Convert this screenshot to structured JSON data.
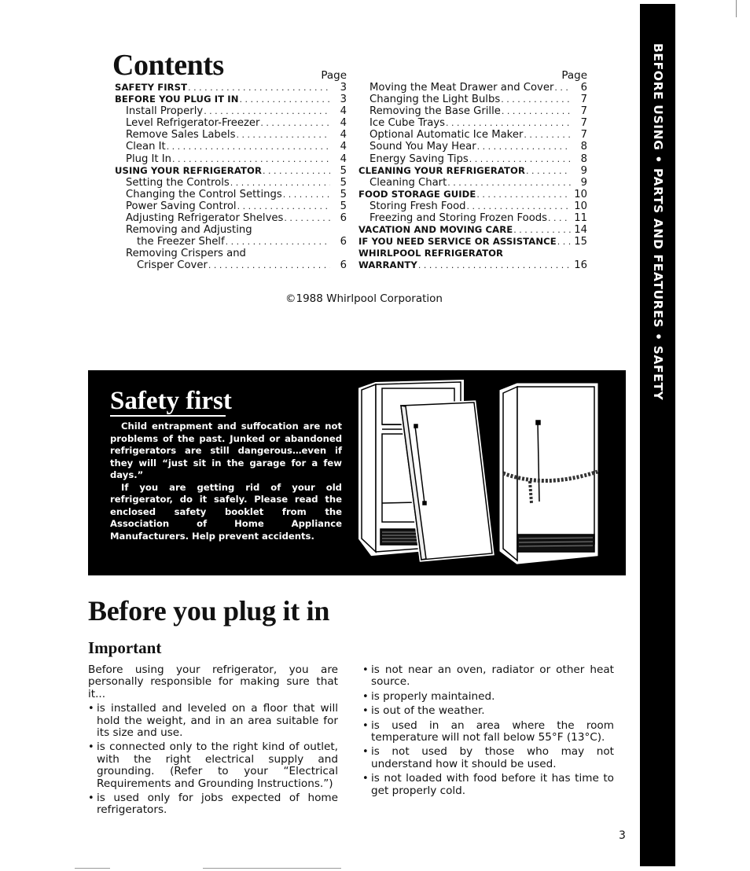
{
  "contents": {
    "title": "Contents",
    "page_header": "Page",
    "left_column": [
      {
        "label": "SAFETY FIRST",
        "page": "3",
        "level": "main"
      },
      {
        "label": "BEFORE YOU PLUG IT IN",
        "page": "3",
        "level": "main"
      },
      {
        "label": "Install Properly",
        "page": "4",
        "level": "sub"
      },
      {
        "label": "Level Refrigerator-Freezer",
        "page": "4",
        "level": "sub"
      },
      {
        "label": "Remove Sales Labels",
        "page": "4",
        "level": "sub"
      },
      {
        "label": "Clean It",
        "page": "4",
        "level": "sub"
      },
      {
        "label": "Plug It In",
        "page": "4",
        "level": "sub"
      },
      {
        "label": "USING YOUR REFRIGERATOR",
        "page": "5",
        "level": "main"
      },
      {
        "label": "Setting the Controls",
        "page": "5",
        "level": "sub"
      },
      {
        "label": "Changing the Control Settings",
        "page": "5",
        "level": "sub"
      },
      {
        "label": "Power Saving Control",
        "page": "5",
        "level": "sub"
      },
      {
        "label": "Adjusting Refrigerator Shelves",
        "page": "6",
        "level": "sub"
      },
      {
        "label": "Removing and Adjusting",
        "page": "",
        "level": "sub-head"
      },
      {
        "label": "the Freezer Shelf",
        "page": "6",
        "level": "sub2"
      },
      {
        "label": "Removing Crispers and",
        "page": "",
        "level": "sub-head"
      },
      {
        "label": "Crisper Cover",
        "page": "6",
        "level": "sub2"
      }
    ],
    "right_column": [
      {
        "label": "Moving the Meat Drawer and Cover",
        "page": "6",
        "level": "sub"
      },
      {
        "label": "Changing the Light Bulbs",
        "page": "7",
        "level": "sub"
      },
      {
        "label": "Removing the Base Grille",
        "page": "7",
        "level": "sub"
      },
      {
        "label": "Ice Cube Trays",
        "page": "7",
        "level": "sub"
      },
      {
        "label": "Optional Automatic Ice Maker",
        "page": "7",
        "level": "sub"
      },
      {
        "label": "Sound You May Hear",
        "page": "8",
        "level": "sub"
      },
      {
        "label": "Energy Saving Tips",
        "page": "8",
        "level": "sub"
      },
      {
        "label": "CLEANING YOUR REFRIGERATOR",
        "page": "9",
        "level": "main"
      },
      {
        "label": "Cleaning Chart",
        "page": "9",
        "level": "sub"
      },
      {
        "label": "FOOD STORAGE GUIDE",
        "page": "10",
        "level": "main"
      },
      {
        "label": "Storing Fresh Food",
        "page": "10",
        "level": "sub"
      },
      {
        "label": "Freezing and Storing Frozen Foods",
        "page": "11",
        "level": "sub"
      },
      {
        "label": "VACATION AND MOVING CARE",
        "page": "14",
        "level": "main"
      },
      {
        "label": "IF YOU NEED SERVICE OR ASSISTANCE",
        "page": "15",
        "level": "main"
      },
      {
        "label": "WHIRLPOOL REFRIGERATOR",
        "page": "",
        "level": "main-head"
      },
      {
        "label": "WARRANTY",
        "page": "16",
        "level": "main"
      }
    ],
    "copyright": "©1988 Whirlpool Corporation"
  },
  "side_tab": {
    "text": "BEFORE USING • PARTS AND FEATURES • SAFETY"
  },
  "safety": {
    "title": "Safety first",
    "paragraphs": [
      "Child entrapment and suffocation are not problems of the past. Junked or abandoned refrigerators are still dangerous…even if they will “just sit in the garage for a few days.”",
      "If you are getting rid of your old refrigerator, do it safely. Please read the enclosed safety booklet from the Association of Home Appliance Manufacturers. Help prevent accidents."
    ],
    "illustration": "refrigerator-door-removed-and-chained-illustration"
  },
  "before_you_plug": {
    "title": "Before you plug it in",
    "subtitle": "Important",
    "intro": "Before using your refrigerator, you are personally responsible for making sure that it...",
    "left_bullets": [
      "is installed and leveled on a floor that will hold the weight, and in an area suitable for its size and use.",
      "is connected only to the right kind of outlet, with the right electrical supply and grounding. (Refer to your “Electrical Requirements and Grounding Instructions.”)",
      "is used only for jobs expected of home refrigerators."
    ],
    "right_bullets": [
      "is not near an oven, radiator or other heat source.",
      "is properly maintained.",
      "is out of the weather.",
      "is used in an area where the room temperature will not fall below 55°F (13°C).",
      "is not used by those who may not understand how it should be used.",
      "is not loaded with food before it has time to get properly cold."
    ],
    "bullet_glyph": "•"
  },
  "page_number": "3"
}
